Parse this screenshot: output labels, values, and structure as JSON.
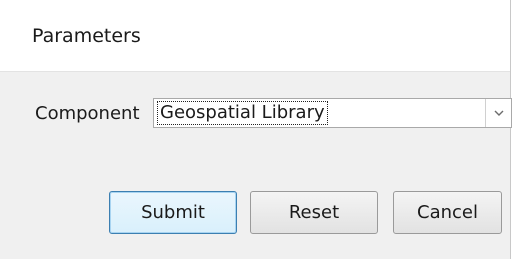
{
  "dialog": {
    "title": "Parameters"
  },
  "form": {
    "component_label": "Component",
    "component_value": "Geospatial Library"
  },
  "buttons": {
    "submit": "Submit",
    "reset": "Reset",
    "cancel": "Cancel"
  },
  "icons": {
    "dropdown": "chevron-down-icon"
  },
  "colors": {
    "panel_background": "#f0f0f0",
    "header_background": "#ffffff",
    "default_button_border": "#3c7fb1"
  }
}
